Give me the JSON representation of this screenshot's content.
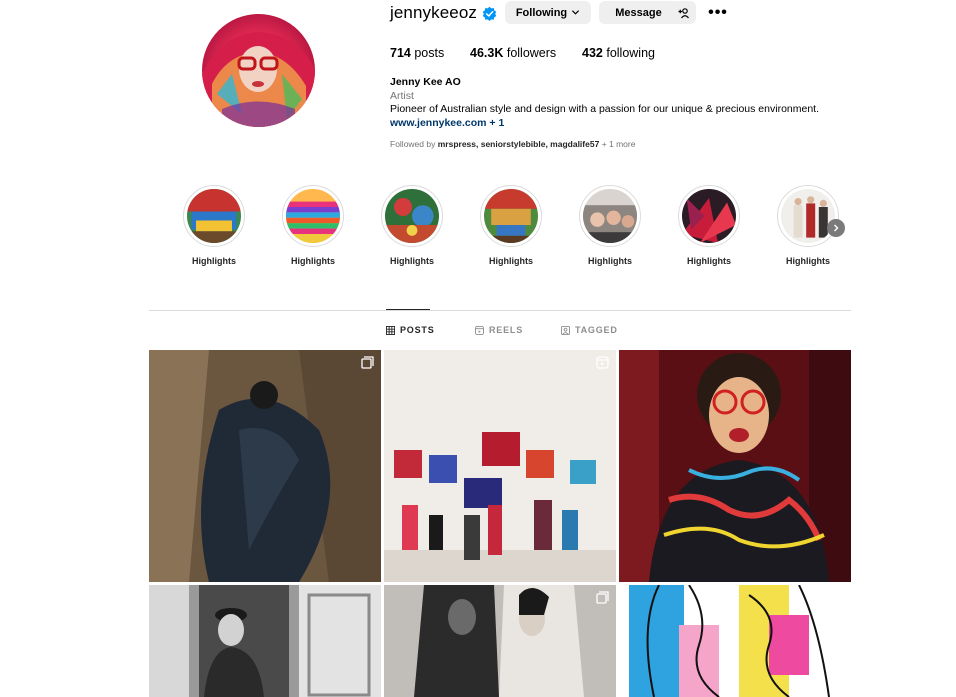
{
  "profile": {
    "username": "jennykeeoz",
    "following_label": "Following",
    "message_label": "Message",
    "more_label": "•••",
    "posts_count": "714",
    "posts_label": "posts",
    "followers_count": "46.3K",
    "followers_label": "followers",
    "following_count": "432",
    "following_count_label": "following",
    "full_name": "Jenny Kee AO",
    "category": "Artist",
    "bio": "Pioneer of Australian style and design with a passion for our unique & precious environment.",
    "link": "www.jennykee.com",
    "link_extra": "+ 1",
    "followed_by_prefix": "Followed by",
    "followed_by_names": "mrspress, seniorstylebible, magdalife57",
    "followed_by_more": "+ 1 more"
  },
  "highlights": [
    {
      "label": "Highlights"
    },
    {
      "label": "Highlights"
    },
    {
      "label": "Highlights"
    },
    {
      "label": "Highlights"
    },
    {
      "label": "Highlights"
    },
    {
      "label": "Highlights"
    },
    {
      "label": "Highlights"
    }
  ],
  "tabs": {
    "posts": "POSTS",
    "reels": "REELS",
    "tagged": "TAGGED"
  },
  "colors": {
    "verified_blue": "#0095f6",
    "link_blue": "#00376b",
    "button_bg": "#efefef"
  },
  "icons": {
    "verified": "verified-badge-icon",
    "posts": "grid-icon",
    "reels": "reels-icon",
    "tagged": "tagged-icon",
    "carousel": "carousel-icon",
    "reel": "reel-icon"
  }
}
